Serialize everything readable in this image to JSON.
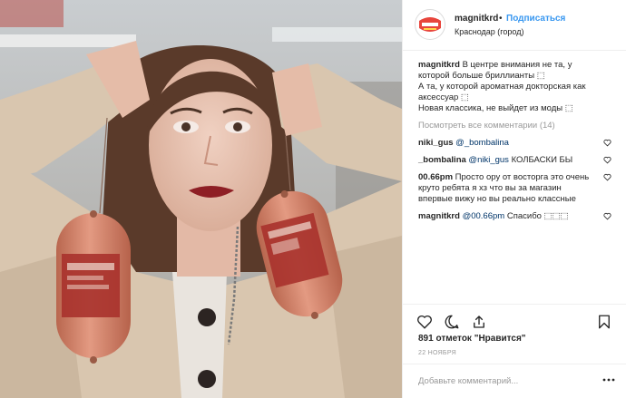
{
  "header": {
    "username": "magnitkrd",
    "separator": "•",
    "follow_label": "Подписаться",
    "location": "Краснодар (город)",
    "avatar_logo_text": "СЕМЕЙНЫЙ",
    "avatar_brand_color": "#e8453c"
  },
  "caption": {
    "user": "magnitkrd",
    "line1": " В центре внимания не та, у которой больше бриллианты ⬚",
    "line2": "А та, у которой ароматная докторская как аксессуар ⬚",
    "line3": "Новая классика, не выйдет из моды ⬚"
  },
  "view_all": "Посмотреть все комментарии (14)",
  "comments": [
    {
      "user": "niki_gus",
      "mention": " @_bombalina",
      "text": ""
    },
    {
      "user": "_bombalina",
      "mention": " @niki_gus",
      "text": " КОЛБАСКИ БЫ"
    },
    {
      "user": "00.66pm",
      "mention": "",
      "text": " Просто ору от восторга это очень круто ребята я хз что вы за магазин впервые вижу но вы реально классные"
    },
    {
      "user": "magnitkrd",
      "mention": " @00.66pm",
      "text": " Спасибо ⬚⬚⬚"
    }
  ],
  "actions": {
    "like_icon": "heart-icon",
    "comment_icon": "comment-icon",
    "share_icon": "share-icon",
    "save_icon": "bookmark-icon"
  },
  "likes": "891 отметок \"Нравится\"",
  "date": "22 НОЯБРЯ",
  "add_comment_placeholder": "Добавьте комментарий...",
  "more_label": "•••",
  "photo": {
    "sausage_label_text": "ВКУС",
    "sausage_color": "#d2826a",
    "label_color": "#a8322c",
    "coat_color": "#d9c6af",
    "lips_color": "#8e1f25"
  }
}
